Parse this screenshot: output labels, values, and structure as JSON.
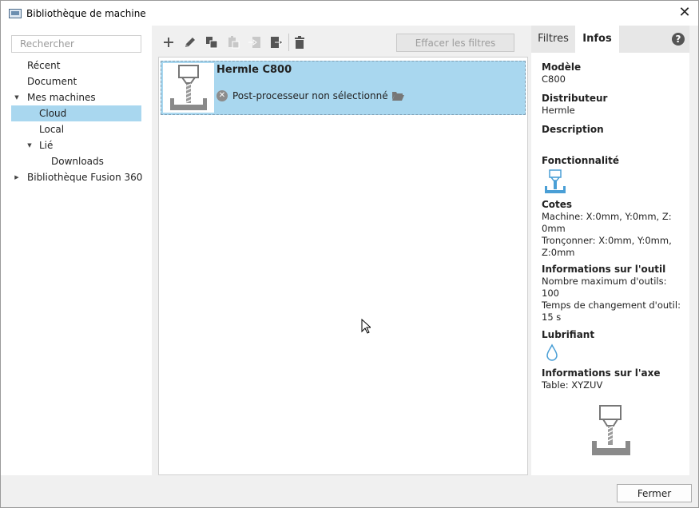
{
  "window": {
    "title": "Bibliothèque de machine",
    "close_glyph": "✕"
  },
  "search": {
    "placeholder": "Rechercher"
  },
  "tree": [
    {
      "label": "Récent"
    },
    {
      "label": "Document"
    },
    {
      "label": "Mes machines",
      "arrow": "▼"
    },
    {
      "label": "Cloud",
      "selected": true
    },
    {
      "label": "Local"
    },
    {
      "label": "Lié",
      "arrow": "▼"
    },
    {
      "label": "Downloads"
    },
    {
      "label": "Bibliothèque Fusion 360",
      "arrow": "▶"
    }
  ],
  "toolbar": {
    "icons": [
      "plus-icon",
      "pencil-icon",
      "duplicate-icon",
      "paste-icon",
      "import-icon",
      "export-icon",
      "trash-icon"
    ],
    "clear_filters_label": "Effacer les filtres"
  },
  "machine": {
    "name": "Hermle C800",
    "post_processor_status": "Post-processeur non sélectionné"
  },
  "tabs": {
    "filters": "Filtres",
    "info": "Infos",
    "help_glyph": "?"
  },
  "info": {
    "model_label": "Modèle",
    "model_value": "C800",
    "distributor_label": "Distributeur",
    "distributor_value": "Hermle",
    "description_label": "Description",
    "functionality_label": "Fonctionnalité",
    "dimensions_label": "Cotes",
    "dimensions_machine": "Machine: X:0mm, Y:0mm, Z: 0mm",
    "dimensions_cutoff": "Tronçonner: X:0mm, Y:0mm, Z:0mm",
    "tool_label": "Informations sur l'outil",
    "tool_max": "Nombre maximum d'outils: 100",
    "tool_change": "Temps de changement d'outil: 15 s",
    "coolant_label": "Lubrifiant",
    "axis_label": "Informations sur l'axe",
    "axis_value": "Table: XYZUV"
  },
  "footer": {
    "close_label": "Fermer"
  },
  "colors": {
    "selection": "#a9d7ef",
    "icon_blue": "#4a9fd6",
    "icon_gray": "#666666"
  }
}
